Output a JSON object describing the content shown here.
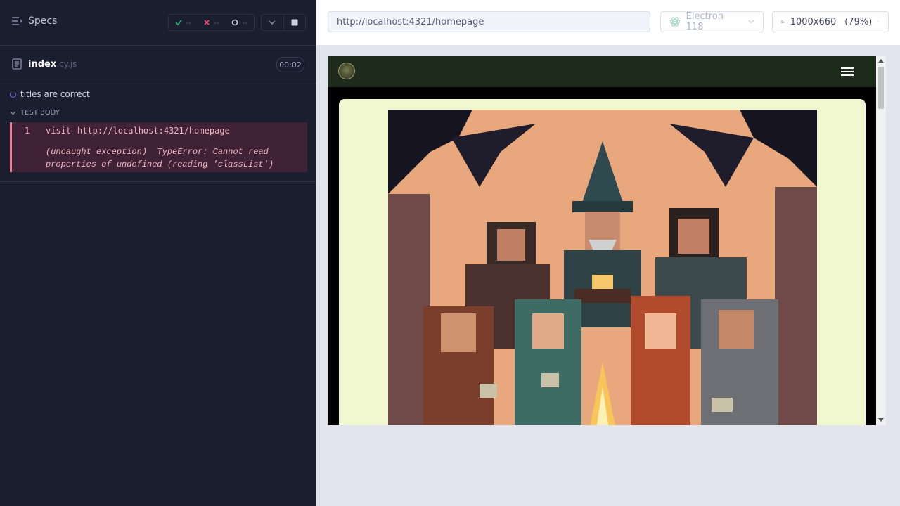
{
  "reporter": {
    "specs_label": "Specs",
    "stats": {
      "passed": "--",
      "failed": "--",
      "pending": "--"
    },
    "spec": {
      "name": "index",
      "ext": ".cy.js",
      "duration": "00:02"
    },
    "test": {
      "title": "titles are correct",
      "body_label": "Test Body",
      "command": {
        "number": "1",
        "name": "visit",
        "message": "http://localhost:4321/homepage",
        "error_line1": "(uncaught exception)  TypeError: Cannot read",
        "error_line2": "properties of undefined (reading 'classList')"
      }
    }
  },
  "aut": {
    "url": "http://localhost:4321/homepage",
    "browser": "Electron 118",
    "viewport": "1000x660",
    "scale": "(79%)"
  },
  "colors": {
    "reporter_bg": "#1b1e2e",
    "pass": "#1fa971",
    "fail": "#f4476a",
    "error_bg": "#3f2235",
    "site_nav": "#1e2a1c",
    "hero_card": "#f1f8d0"
  },
  "icons": {
    "specs": "list-toggle-icon",
    "passed": "check-icon",
    "failed": "x-icon",
    "pending": "ring-icon",
    "stop": "stop-square-icon",
    "chevron": "chevron-down-icon",
    "spec_file": "document-icon",
    "browser": "electron-icon",
    "viewport": "viewport-icon",
    "menu": "hamburger-icon"
  }
}
